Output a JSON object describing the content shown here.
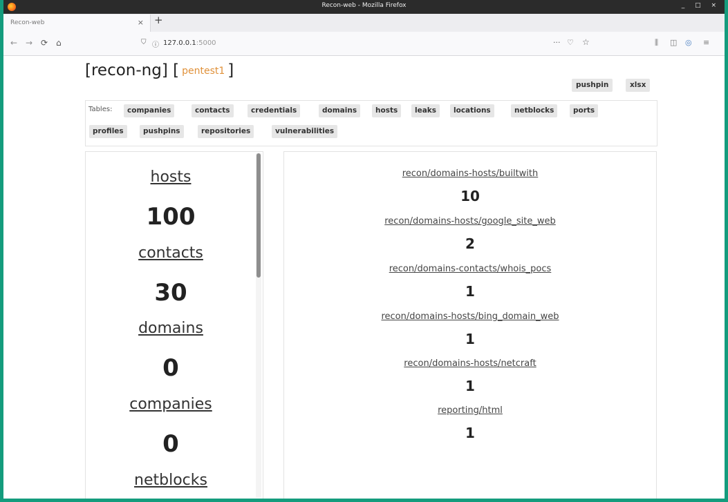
{
  "window": {
    "title": "Recon-web - Mozilla Firefox",
    "controls": "_ □ ×"
  },
  "tab": {
    "label": "Recon-web",
    "close": "×",
    "new_tab": "+"
  },
  "nav": {
    "back": "←",
    "forward": "→",
    "reload": "⟳",
    "home": "⌂",
    "url_host": "127.0.0.1",
    "url_port": ":5000",
    "shield": "⛉",
    "info": "ⓘ",
    "more": "···",
    "pocket": "♡",
    "star": "☆",
    "library": "⫼",
    "sidebar": "◫",
    "extension": "◎",
    "menu": "≡"
  },
  "header": {
    "title_prefix": "[recon-ng] [",
    "workspace": "pentest1",
    "title_suffix": "]",
    "buttons": [
      "pushpin",
      "xlsx"
    ]
  },
  "tables": {
    "label": "Tables:",
    "items": [
      "companies",
      "contacts",
      "credentials",
      "domains",
      "hosts",
      "leaks",
      "locations",
      "netblocks",
      "ports",
      "profiles",
      "pushpins",
      "repositories",
      "vulnerabilities"
    ]
  },
  "summary": [
    {
      "name": "hosts",
      "count": "100"
    },
    {
      "name": "contacts",
      "count": "30"
    },
    {
      "name": "domains",
      "count": "0"
    },
    {
      "name": "companies",
      "count": "0"
    },
    {
      "name": "netblocks",
      "count": ""
    }
  ],
  "modules": [
    {
      "name": "recon/domains-hosts/builtwith",
      "count": "10"
    },
    {
      "name": "recon/domains-hosts/google_site_web",
      "count": "2"
    },
    {
      "name": "recon/domains-contacts/whois_pocs",
      "count": "1"
    },
    {
      "name": "recon/domains-hosts/bing_domain_web",
      "count": "1"
    },
    {
      "name": "recon/domains-hosts/netcraft",
      "count": "1"
    },
    {
      "name": "reporting/html",
      "count": "1"
    }
  ]
}
